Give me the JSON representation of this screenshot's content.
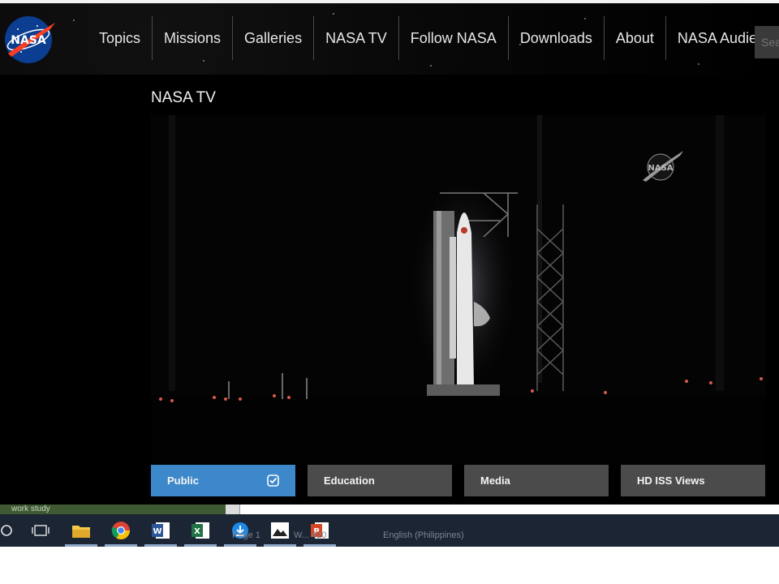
{
  "site": {
    "logo_text": "NASA",
    "nav": [
      "Topics",
      "Missions",
      "Galleries",
      "NASA TV",
      "Follow NASA",
      "Downloads",
      "About",
      "NASA Audiences"
    ],
    "search_placeholder": "Sea",
    "section_title": "NASA TV",
    "player": {
      "watermark": "NASA"
    },
    "tabs": [
      {
        "label": "Public",
        "active": true
      },
      {
        "label": "Education",
        "active": false
      },
      {
        "label": "Media",
        "active": false
      },
      {
        "label": "HD ISS Views",
        "active": false
      }
    ],
    "colors": {
      "background": "#000000",
      "tab_active": "#3d87cb",
      "tab_inactive": "#4b4b4b"
    }
  },
  "word_doc": {
    "sidebar_text": "work study"
  },
  "taskbar": {
    "apps": [
      "search",
      "task-view",
      "file-explorer",
      "chrome",
      "word",
      "excel",
      "downloads",
      "photos",
      "powerpoint"
    ],
    "status_page": "Page 1",
    "status_words": "W... 420",
    "status_language": "English (Philippines)"
  }
}
